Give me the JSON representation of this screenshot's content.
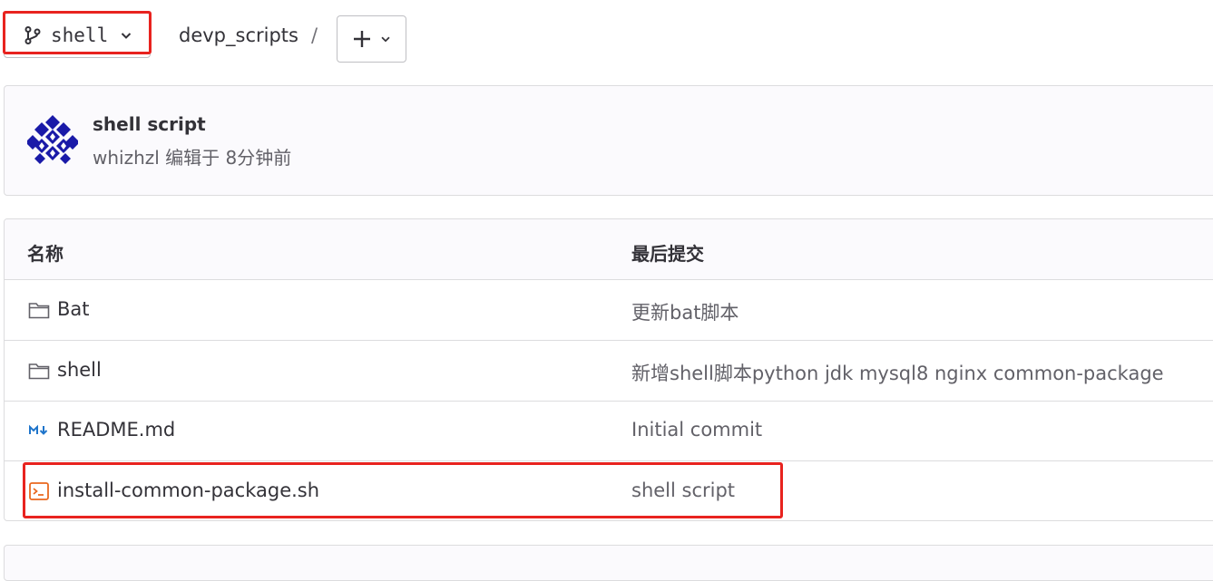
{
  "header": {
    "branch_name": "shell",
    "breadcrumb_project": "devp_scripts",
    "breadcrumb_separator": "/",
    "add_button_symbol": "+"
  },
  "commit": {
    "title": "shell script",
    "meta": "whizhzl 编辑于 8分钟前",
    "avatar_icon": "identicon-avatar"
  },
  "table": {
    "columns": [
      "名称",
      "最后提交"
    ],
    "rows": [
      {
        "name": "Bat",
        "icon": "folder-icon",
        "last_commit": "更新bat脚本"
      },
      {
        "name": "shell",
        "icon": "folder-icon",
        "last_commit": "新增shell脚本python jdk mysql8 nginx common-package"
      },
      {
        "name": "README.md",
        "icon": "markdown-icon",
        "last_commit": "Initial commit"
      },
      {
        "name": "install-common-package.sh",
        "icon": "terminal-file-icon",
        "last_commit": "shell script"
      }
    ]
  },
  "colors": {
    "highlight": "#e8231f",
    "markdown_icon": "#1f75cb",
    "terminal_icon": "#e9681f",
    "avatar": "#1a1aa8"
  }
}
